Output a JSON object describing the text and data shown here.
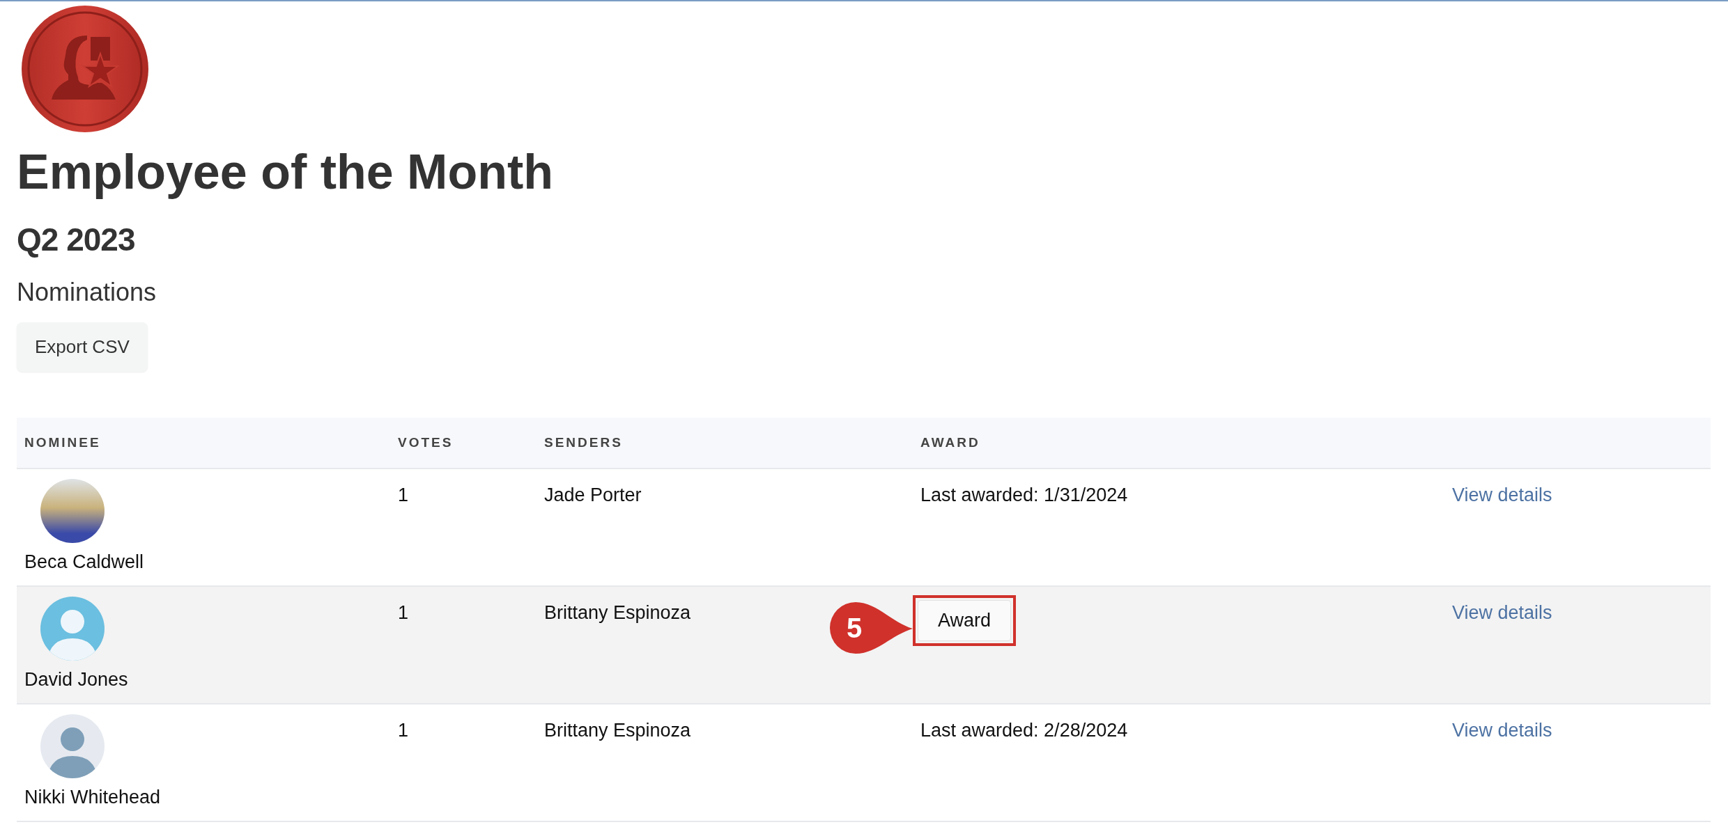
{
  "header": {
    "title": "Employee of the Month",
    "period": "Q2 2023",
    "section": "Nominations",
    "export_button": "Export CSV"
  },
  "table": {
    "columns": [
      "NOMINEE",
      "VOTES",
      "SENDERS",
      "AWARD"
    ],
    "rows": [
      {
        "nominee": "Beca Caldwell",
        "avatar": {
          "kind": "photo"
        },
        "votes": "1",
        "senders": "Jade Porter",
        "award": {
          "kind": "text",
          "text": "Last awarded: 1/31/2024"
        },
        "link": "View details",
        "selected": false
      },
      {
        "nominee": "David Jones",
        "avatar": {
          "kind": "default-blue"
        },
        "votes": "1",
        "senders": "Brittany Espinoza",
        "award": {
          "kind": "button",
          "text": "Award",
          "callout": "5"
        },
        "link": "View details",
        "selected": true
      },
      {
        "nominee": "Nikki Whitehead",
        "avatar": {
          "kind": "default-gray"
        },
        "votes": "1",
        "senders": "Brittany Espinoza",
        "award": {
          "kind": "text",
          "text": "Last awarded: 2/28/2024"
        },
        "link": "View details",
        "selected": false
      }
    ]
  }
}
